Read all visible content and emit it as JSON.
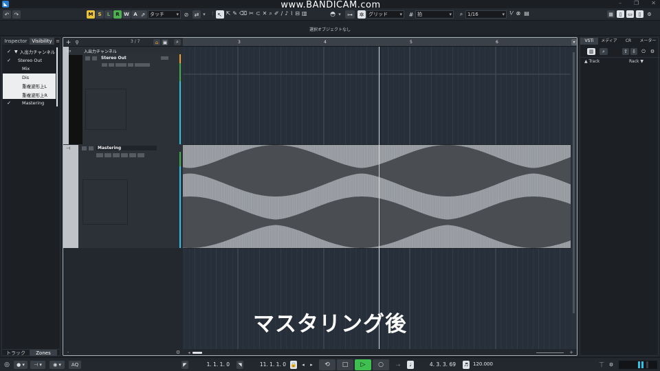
{
  "title_bar": {
    "watermark": "www.BANDICAM.com"
  },
  "toolbar": {
    "modes": [
      {
        "letter": "M",
        "bg": "#e8c23a",
        "fg": "#111"
      },
      {
        "letter": "S",
        "bg": "#3a4047",
        "fg": "#e8c23a"
      },
      {
        "letter": "L",
        "bg": "#3a4047",
        "fg": "#6fa66f"
      },
      {
        "letter": "R",
        "bg": "#4caf50",
        "fg": "#111"
      },
      {
        "letter": "W",
        "bg": "#3a4047",
        "fg": "#ddd"
      },
      {
        "letter": "A",
        "bg": "#3a4047",
        "fg": "#ddd"
      }
    ],
    "automation_mode": "タッチ",
    "snap_type": "グリッド",
    "grid_type": "拍",
    "quantize": "1/16"
  },
  "info_line": {
    "text": "選択オブジェクトなし"
  },
  "left_zone": {
    "tabs": [
      "Inspector",
      "Visibility"
    ],
    "items": [
      {
        "check": "✓",
        "label": "入出力チャンネル",
        "style": "dark",
        "indent": false
      },
      {
        "check": "✓",
        "label": "Stereo Out",
        "style": "dark",
        "indent": true
      },
      {
        "check": "",
        "label": "Mix",
        "style": "dark",
        "indent": false
      },
      {
        "check": "",
        "label": "Dis",
        "style": "light",
        "indent": false
      },
      {
        "check": "",
        "label": "重複波形上L",
        "style": "light",
        "indent": false
      },
      {
        "check": "",
        "label": "重複波形上R",
        "style": "light",
        "indent": false
      },
      {
        "check": "✓",
        "label": "Mastering",
        "style": "dark",
        "indent": false
      }
    ],
    "bottom_tabs": [
      "トラック",
      "Zones"
    ]
  },
  "track_list": {
    "header_counter": "3 / 7",
    "folder_label": "入出力チャンネル",
    "tracks": [
      {
        "name": "Stereo Out"
      },
      {
        "name": "Mastering"
      }
    ]
  },
  "ruler": {
    "bars": [
      "3",
      "4",
      "5",
      "6"
    ]
  },
  "overlay": {
    "caption": "マスタリング後"
  },
  "right_zone": {
    "tabs": [
      "VSTi",
      "メディア",
      "CR",
      "メーター"
    ],
    "track_label": "▲ Track",
    "rack_label": "Rack ▼"
  },
  "transport": {
    "left_locator": "1. 1. 1. 0",
    "right_locator": "11. 1. 1. 0",
    "position": "4. 3. 3. 69",
    "tempo": "120.000",
    "aq_label": "AQ"
  },
  "colors": {
    "accent": "#33c1e6",
    "green": "#3fbf4f",
    "record": "#4caf50"
  }
}
